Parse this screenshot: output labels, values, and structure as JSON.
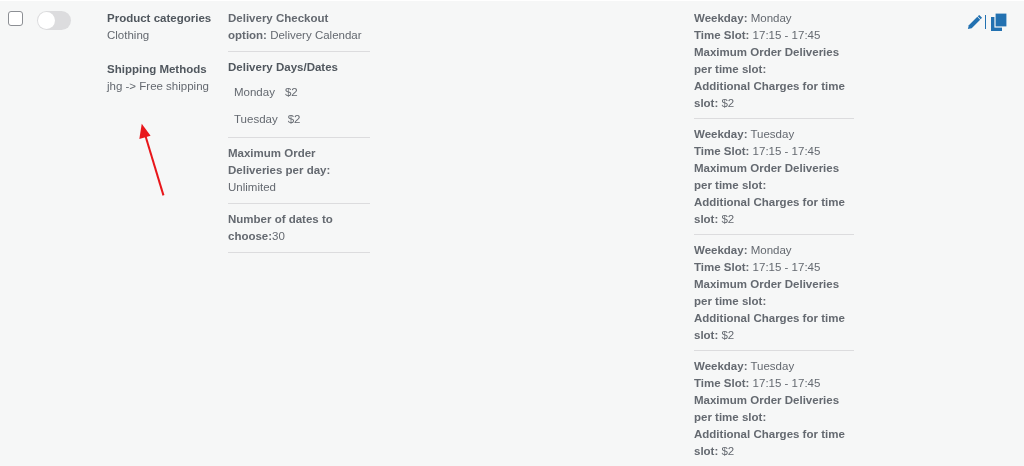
{
  "row": {
    "checked": false,
    "enabled": false
  },
  "conditions": [
    {
      "heading": "Product categories",
      "value": "Clothing"
    },
    {
      "heading": "Shipping Methods",
      "value": "jhg -> Free shipping"
    }
  ],
  "delivery": {
    "checkout_option": "**Delivery Checkout option:** Delivery Calendar",
    "days_heading": "Delivery Days/Dates",
    "days": [
      {
        "day": "Monday",
        "charge": "$2"
      },
      {
        "day": "Tuesday",
        "charge": "$2"
      }
    ],
    "max_per_day": "**Maximum Order Deliveries per day:** Unlimited",
    "dates_to_choose": "**Number of dates to choose:**30"
  },
  "time_slots": [
    {
      "lines": [
        "**Weekday:** Monday",
        "**Time Slot:** 17:15 - 17:45",
        "**Maximum Order Deliveries per time slot:**",
        "**Additional Charges for time slot:** $2"
      ]
    },
    {
      "lines": [
        "**Weekday:** Tuesday",
        "**Time Slot:** 17:15 - 17:45",
        "**Maximum Order Deliveries per time slot:**",
        "**Additional Charges for time slot:** $2"
      ]
    },
    {
      "lines": [
        "**Weekday:** Monday",
        "**Time Slot:** 17:15 - 17:45",
        "**Maximum Order Deliveries per time slot:**",
        "**Additional Charges for time slot:** $2"
      ]
    },
    {
      "lines": [
        "**Weekday:** Tuesday",
        "**Time Slot:** 17:15 - 17:45",
        "**Maximum Order Deliveries per time slot:**",
        "**Additional Charges for time slot:** $2"
      ]
    }
  ]
}
